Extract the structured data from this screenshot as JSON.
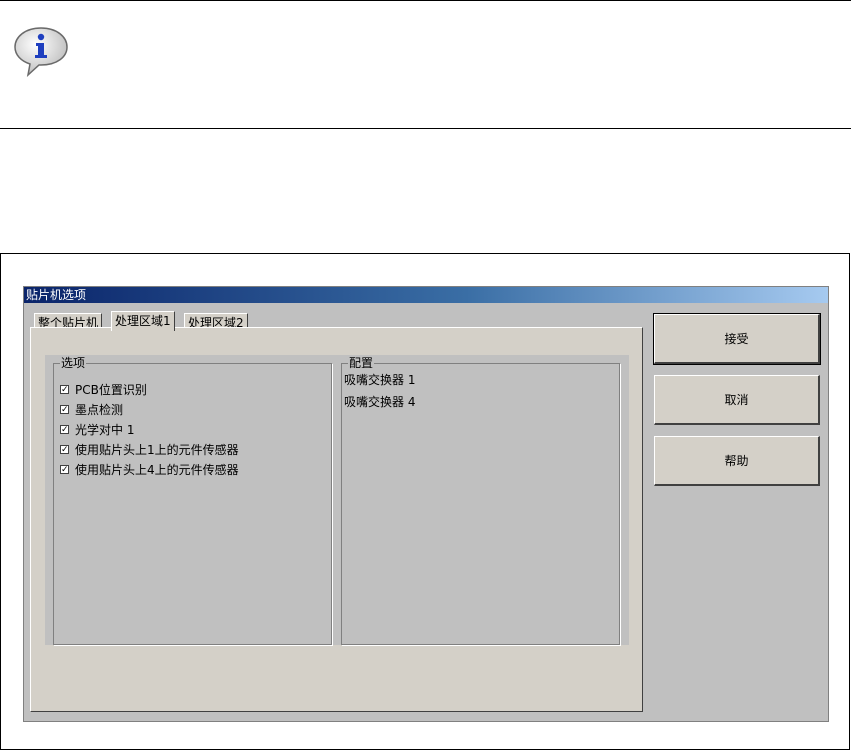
{
  "window": {
    "title": "贴片机选项"
  },
  "tabs": [
    {
      "label": "整个贴片机"
    },
    {
      "label": "处理区域1"
    },
    {
      "label": "处理区域2"
    }
  ],
  "options_group": {
    "title": "选项",
    "items": [
      {
        "label": "PCB位置识别",
        "checked": true
      },
      {
        "label": "墨点检测",
        "checked": true
      },
      {
        "label": "光学对中 1",
        "checked": true
      },
      {
        "label": "使用贴片头上1上的元件传感器",
        "checked": true
      },
      {
        "label": "使用贴片头上4上的元件传感器",
        "checked": true
      }
    ]
  },
  "config_group": {
    "title": "配置",
    "items": [
      {
        "label": "吸嘴交换器 1"
      },
      {
        "label": "吸嘴交换器 4"
      }
    ]
  },
  "buttons": {
    "accept": "接受",
    "cancel": "取消",
    "help": "帮助"
  },
  "icons": {
    "info": "info-speech-bubble-icon"
  }
}
